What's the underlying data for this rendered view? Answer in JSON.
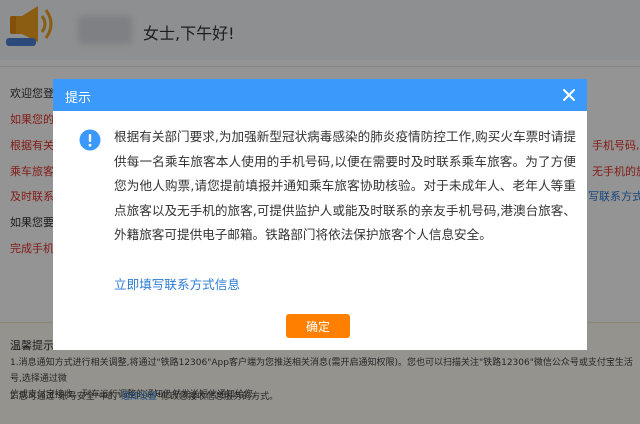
{
  "header": {
    "greeting": "女士,下午好!"
  },
  "page": {
    "lines": [
      "欢迎您登",
      "如果您的",
      "根据有关",
      "乘车旅客",
      "及时联系",
      "如果您要",
      "完成手机"
    ],
    "right_red": [
      "手机号码,",
      "无手机的旅",
      "写联系方式"
    ]
  },
  "tips": {
    "title": "温馨提示",
    "line1": "1.消息通知方式进行相关调整,将通过\"铁路12306\"App客户端为您推送相关消息(需开启通知权限)。您也可以扫描关注\"铁路12306\"微信公众号或支付宝生活号,选择通过微",
    "line1b": "信或支付宝接收。列车运行调整的通知仍然发送短信通知给您。",
    "line2a": "2.您可通过\"账号安全\"中的\"",
    "line2_link": "通知设置",
    "line2b": "\"修改您接收信息服务的方式。"
  },
  "dialog": {
    "title": "提示",
    "body": "根据有关部门要求,为加强新型冠状病毒感染的肺炎疫情防控工作,购买火车票时请提供每一名乘车旅客本人使用的手机号码,以便在需要时及时联系乘车旅客。为了方便您为他人购票,请您提前填报并通知乘车旅客协助核验。对于未成年人、老年人等重点旅客以及无手机的旅客,可提供监护人或能及时联系的亲友手机号码,港澳台旅客、外籍旅客可提供电子邮箱。铁路部门将依法保护旅客个人信息安全。",
    "link": "立即填写联系方式信息",
    "ok_button": "确定"
  },
  "colors": {
    "dialog_header": "#3b99fc",
    "ok_button": "#ff8000",
    "link": "#2c7bd3",
    "warning_text": "#e0322b"
  },
  "icons": {
    "header_icon": "speaker-icon",
    "close": "close-icon",
    "info": "info-icon"
  }
}
